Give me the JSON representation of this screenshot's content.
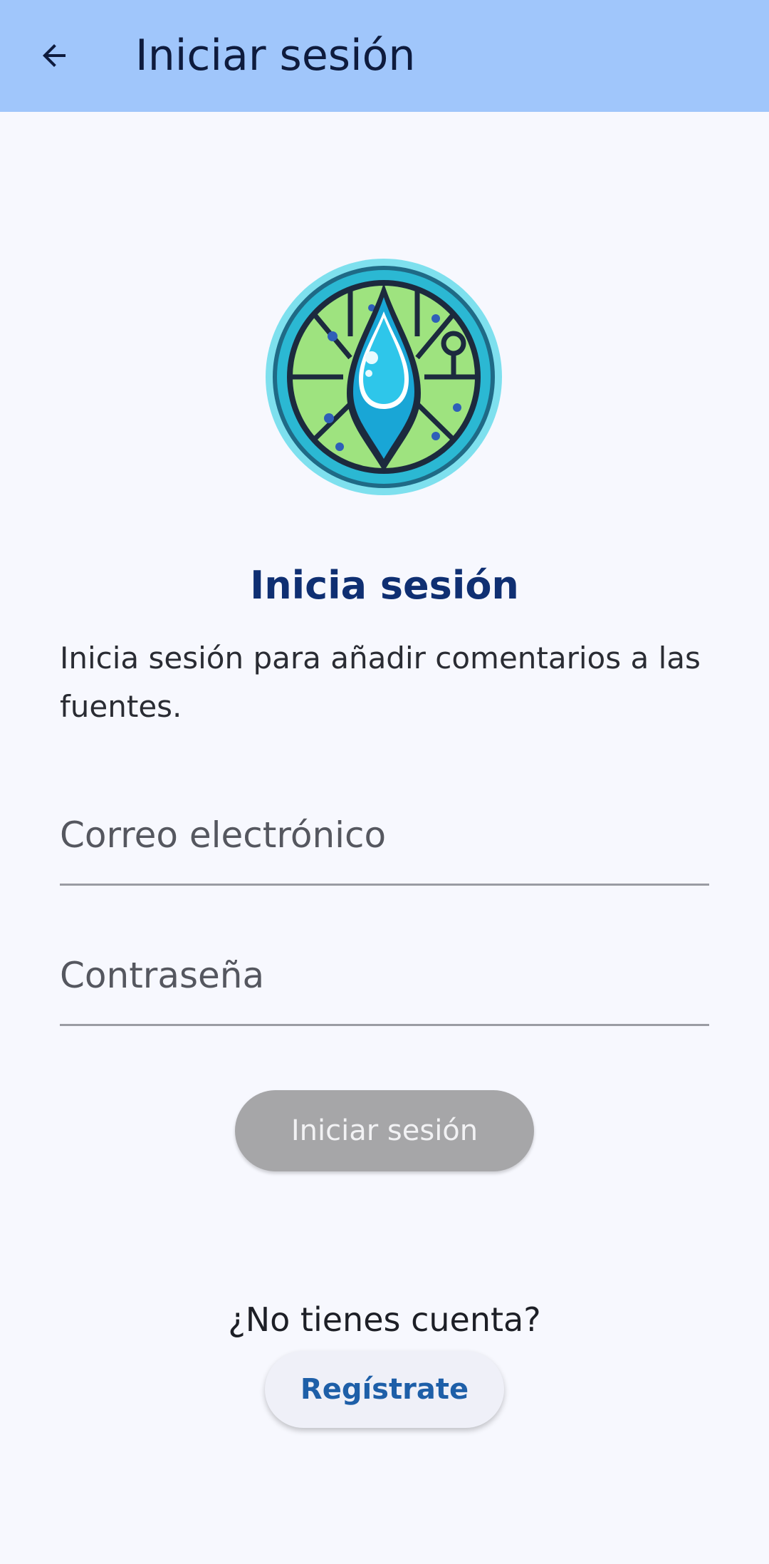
{
  "app_bar": {
    "title": "Iniciar sesión",
    "back_icon": "arrow-back-icon",
    "background_color": "#a0c6fb"
  },
  "logo": {
    "icon": "water-drop-circuit-logo"
  },
  "main": {
    "heading": "Inicia sesión",
    "description": "Inicia sesión para añadir comentarios a las fuentes.",
    "email": {
      "placeholder": "Correo electrónico",
      "value": ""
    },
    "password": {
      "placeholder": "Contraseña",
      "value": ""
    },
    "login_button_label": "Iniciar sesión",
    "no_account_text": "¿No tienes cuenta?",
    "register_button_label": "Regístrate"
  },
  "colors": {
    "heading": "#0f2f72",
    "register_link": "#1e5fa8",
    "disabled_button": "#a6a6a8"
  }
}
